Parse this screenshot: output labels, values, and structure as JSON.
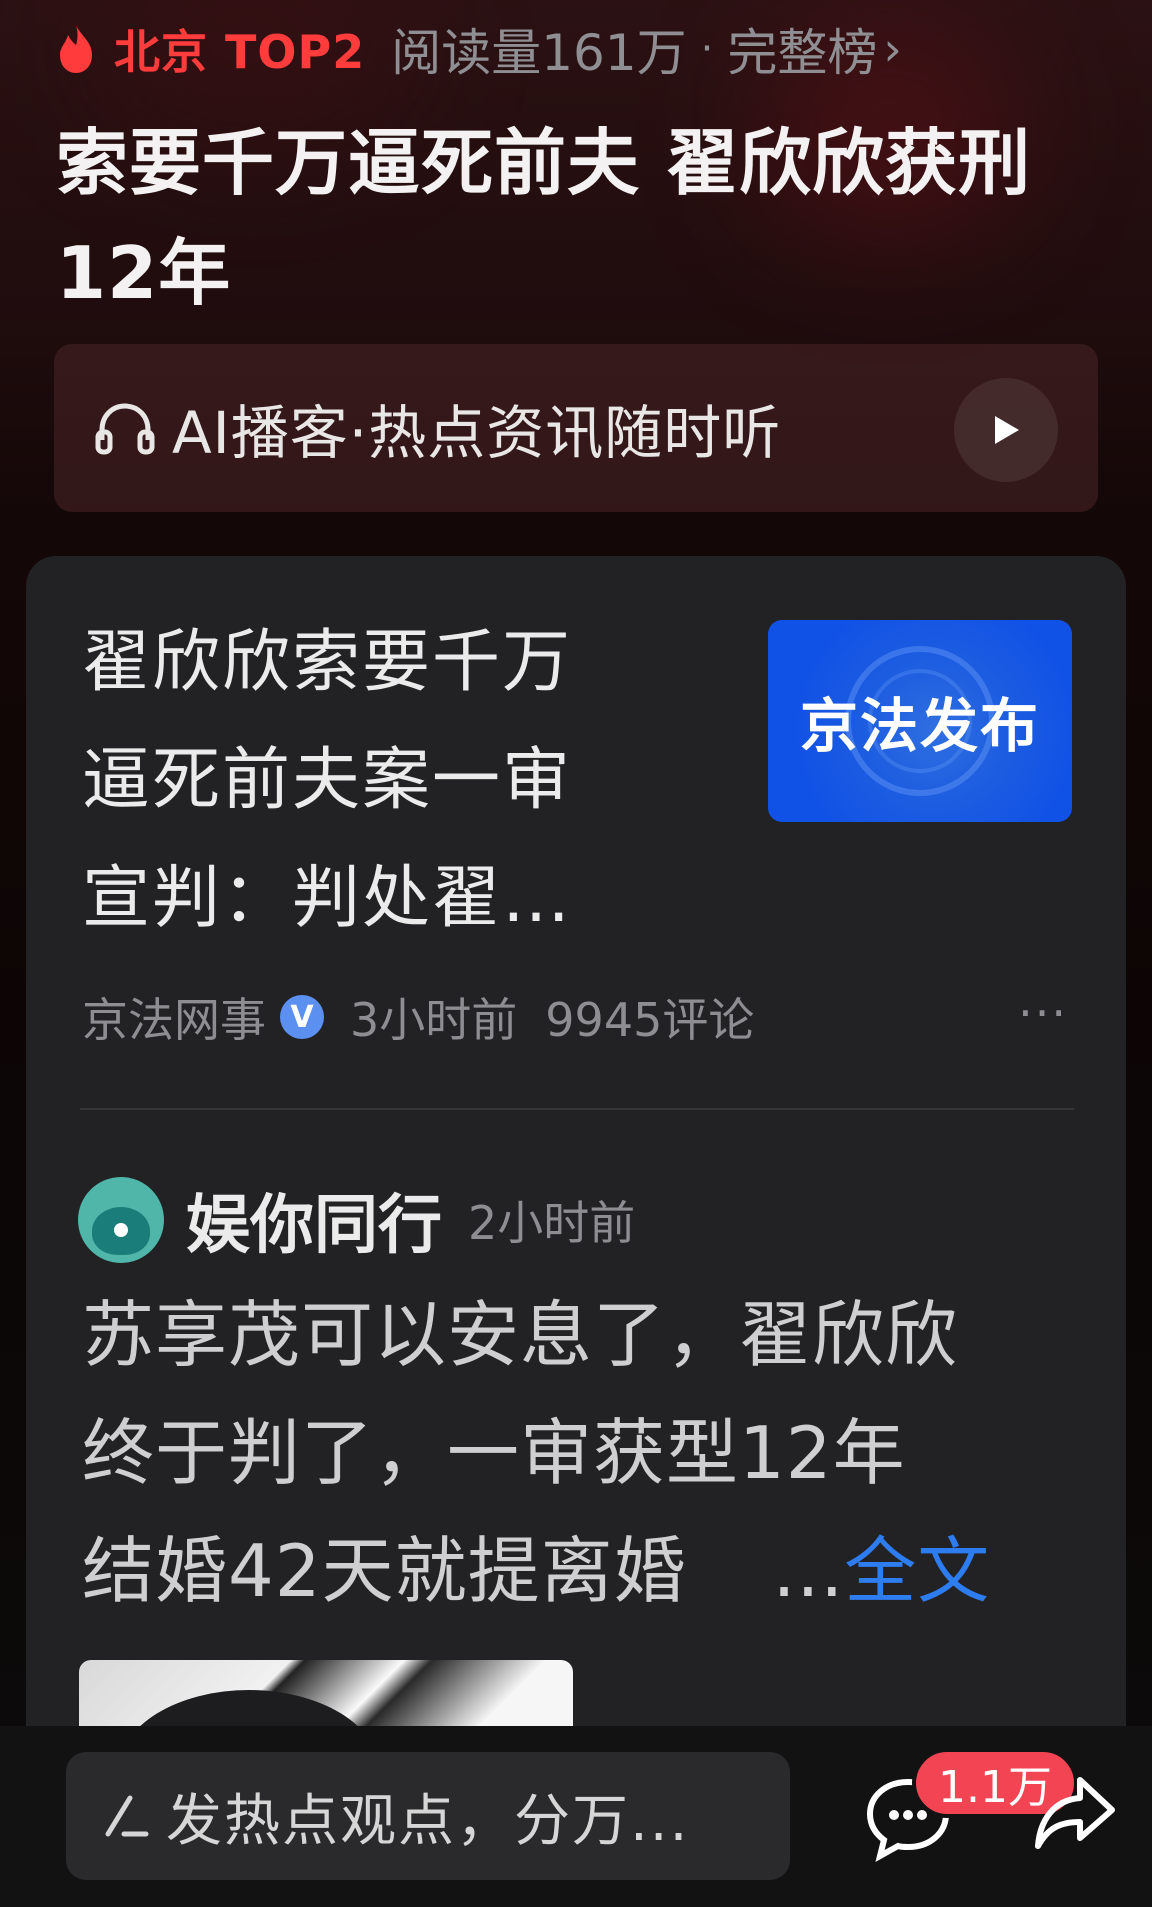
{
  "hot_topic": {
    "location_rank": "北京 TOP2",
    "reads": "阅读量161万",
    "separator": "·",
    "full_rank_label": "完整榜",
    "title": "索要千万逼死前夫 翟欣欣获刑12年"
  },
  "podcast": {
    "label": "AI播客·热点资讯随时听"
  },
  "article": {
    "title": "翟欣欣索要千万逼死前夫案一审宣判：判处翟…",
    "thumbnail_text": "京法发布",
    "source": "京法网事",
    "verified_badge": "V",
    "time": "3小时前",
    "comments": "9945评论",
    "more": "···"
  },
  "post": {
    "author": "娱你同行",
    "time": "2小时前",
    "lines": [
      "苏享茂可以安息了，翟欣欣",
      "终于判了，一审获型12年",
      "结婚42天就提离婚"
    ],
    "ellipsis": "...",
    "full_text_link": "全文"
  },
  "bottom_bar": {
    "comment_placeholder": "发热点观点，分万...",
    "comment_count": "1.1万"
  },
  "colors": {
    "accent_red": "#ff3c3c",
    "link_blue": "#2d7cf0",
    "badge_red": "#f24452"
  },
  "icons": [
    "flame-icon",
    "chevron-right-icon",
    "headphones-icon",
    "play-icon",
    "verified-icon",
    "more-icon",
    "pen-icon",
    "comment-icon",
    "share-icon"
  ]
}
